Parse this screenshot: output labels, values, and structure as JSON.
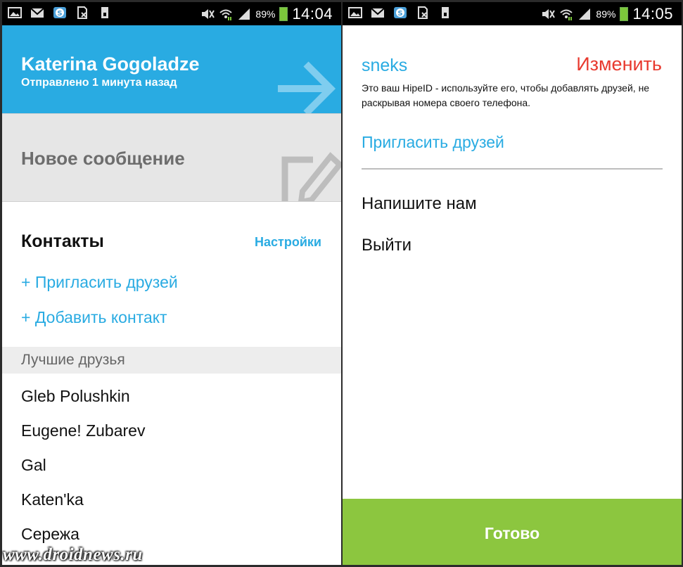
{
  "left": {
    "status": {
      "battery": "89%",
      "time": "14:04"
    },
    "header": {
      "name": "Katerina Gogoladze",
      "subtitle": "Отправлено 1 минута назад"
    },
    "new_message": {
      "label": "Новое сообщение"
    },
    "contacts": {
      "title": "Контакты",
      "settings": "Настройки",
      "invite": "+ Пригласить друзей",
      "add_contact": "+ Добавить контакт",
      "section_label": "Лучшие друзья",
      "items": [
        "Gleb Polushkin",
        "Eugene! Zubarev",
        "Gal",
        "Katen'ka",
        "Сережа"
      ]
    }
  },
  "right": {
    "status": {
      "battery": "89%",
      "time": "14:05"
    },
    "username": "sneks",
    "change": "Изменить",
    "description": "Это ваш HipeID - используйте его, чтобы добавлять друзей, не раскрывая номера своего телефона.",
    "invite": "Пригласить друзей",
    "menu": [
      "Напишите нам",
      "Выйти"
    ],
    "done": "Готово"
  },
  "watermark": "www.droidnews.ru",
  "colors": {
    "accent_blue": "#29abe2",
    "accent_red": "#e8392e",
    "done_green": "#8cc63f",
    "header_gray": "#e6e6e6"
  },
  "icons": {
    "status_left": [
      "gallery-icon",
      "gmail-icon",
      "app-s-icon",
      "sim-no-signal-icon",
      "sd-card-icon"
    ],
    "status_right": [
      "mute-icon",
      "wifi-icon",
      "signal-icon",
      "battery-icon"
    ]
  }
}
